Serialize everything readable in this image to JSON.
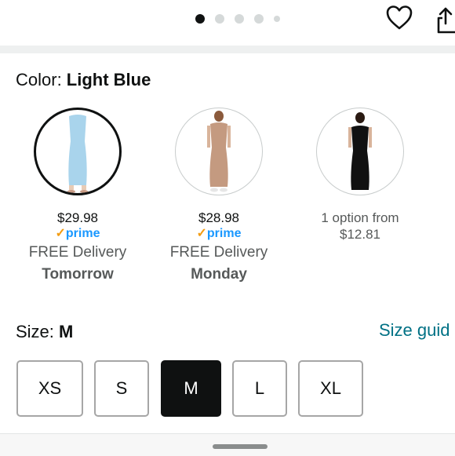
{
  "carousel": {
    "dot_count": 5,
    "active_index": 0
  },
  "icons": {
    "wishlist": "heart-icon",
    "share": "share-icon"
  },
  "color_selector": {
    "label": "Color: ",
    "selected_value": "Light Blue",
    "options": [
      {
        "name": "Light Blue",
        "price": "$29.98",
        "prime": "prime",
        "delivery": "FREE Delivery",
        "delivery_day": "Tomorrow",
        "selected": true,
        "swatch_color": "#a9d4ec"
      },
      {
        "name": "Tan",
        "price": "$28.98",
        "prime": "prime",
        "delivery": "FREE Delivery",
        "delivery_day": "Monday",
        "selected": false,
        "swatch_color": "#c49a80"
      },
      {
        "name": "Black",
        "options_line1": "1 option from",
        "options_line2": "$12.81",
        "selected": false,
        "swatch_color": "#111111"
      }
    ]
  },
  "size_selector": {
    "label": "Size: ",
    "selected_value": "M",
    "guide_link": "Size guid",
    "sizes": [
      "XS",
      "S",
      "M",
      "L",
      "XL"
    ]
  },
  "colors": {
    "link": "#007185",
    "prime_blue": "#1a98ff",
    "prime_check": "#f39c12",
    "selected": "#0f1111"
  }
}
